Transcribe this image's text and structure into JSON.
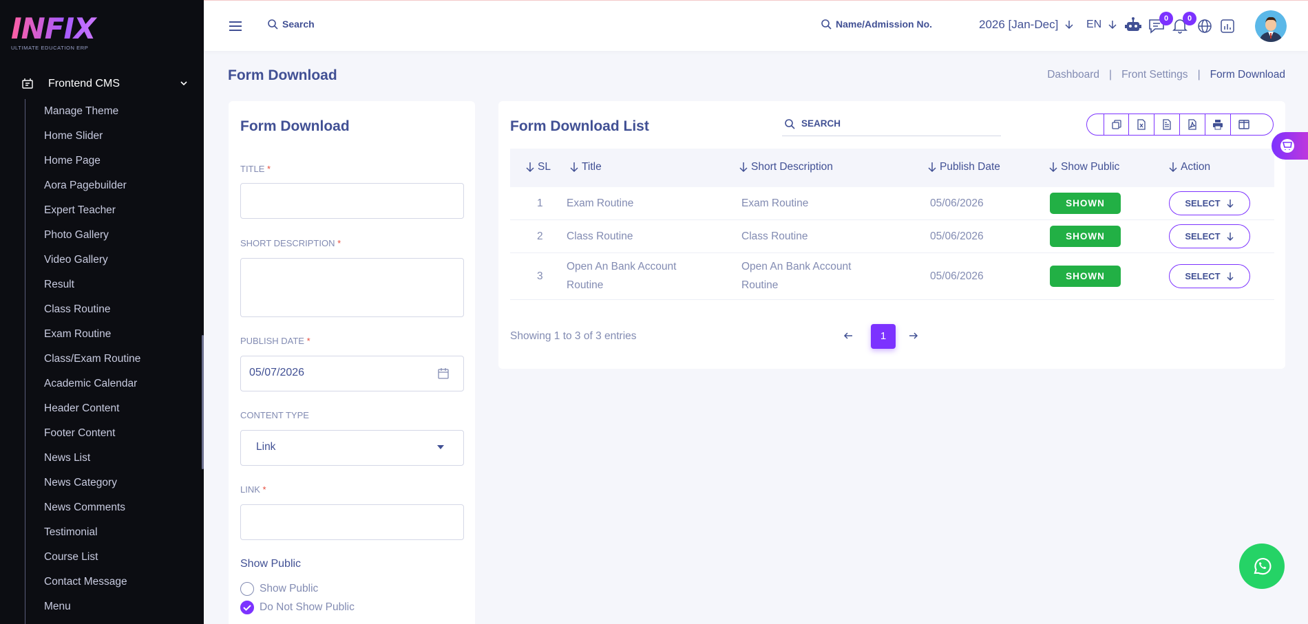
{
  "sidebar": {
    "logo_text": "INFIX",
    "logo_sub": "ULTIMATE EDUCATION ERP",
    "section_label": "Frontend CMS",
    "items": [
      "Manage Theme",
      "Home Slider",
      "Home Page",
      "Aora Pagebuilder",
      "Expert Teacher",
      "Photo Gallery",
      "Video Gallery",
      "Result",
      "Class Routine",
      "Exam Routine",
      "Class/Exam Routine",
      "Academic Calendar",
      "Header Content",
      "Footer Content",
      "News List",
      "News Category",
      "News Comments",
      "Testimonial",
      "Course List",
      "Contact Message",
      "Menu"
    ]
  },
  "topbar": {
    "search_label": "Search",
    "student_search_label": "Name/Admission No.",
    "academic_year": "2026 [Jan-Dec]",
    "language": "EN",
    "chat_count": "0",
    "notification_count": "0"
  },
  "page": {
    "title": "Form Download",
    "breadcrumb": [
      "Dashboard",
      "Front Settings",
      "Form Download"
    ]
  },
  "form": {
    "title": "Form Download",
    "title_label": "TITLE",
    "short_desc_label": "SHORT DESCRIPTION",
    "publish_date_label": "PUBLISH DATE",
    "publish_date_value": "05/07/2026",
    "content_type_label": "CONTENT TYPE",
    "content_type_value": "Link",
    "link_label": "LINK",
    "required_mark": "*",
    "show_public_label": "Show Public",
    "radio_show": "Show Public",
    "radio_hide": "Do Not Show Public"
  },
  "list": {
    "title": "Form Download List",
    "search_placeholder": "SEARCH",
    "columns": [
      "SL",
      "Title",
      "Short Description",
      "Publish Date",
      "Show Public",
      "Action"
    ],
    "rows": [
      {
        "sl": "1",
        "title": "Exam Routine",
        "title2": "",
        "desc": "Exam Routine",
        "desc2": "",
        "date": "05/06/2026",
        "status": "SHOWN",
        "action": "SELECT"
      },
      {
        "sl": "2",
        "title": "Class Routine",
        "title2": "",
        "desc": "Class Routine",
        "desc2": "",
        "date": "05/06/2026",
        "status": "SHOWN",
        "action": "SELECT"
      },
      {
        "sl": "3",
        "title": "Open An Bank Account",
        "title2": "Routine",
        "desc": "Open An Bank Account",
        "desc2": "Routine",
        "date": "05/06/2026",
        "status": "SHOWN",
        "action": "SELECT"
      }
    ],
    "showing": "Showing 1 to 3 of 3 entries",
    "current_page": "1"
  },
  "colors": {
    "accent": "#7c32ff",
    "text": "#415094",
    "muted": "#828bb2",
    "success": "#22b045",
    "sidebar_bg": "#0c0d12",
    "whatsapp": "#25d366"
  },
  "icons": {
    "export": [
      "copy-icon",
      "excel-icon",
      "csv-icon",
      "pdf-icon",
      "print-icon",
      "columns-icon"
    ]
  }
}
